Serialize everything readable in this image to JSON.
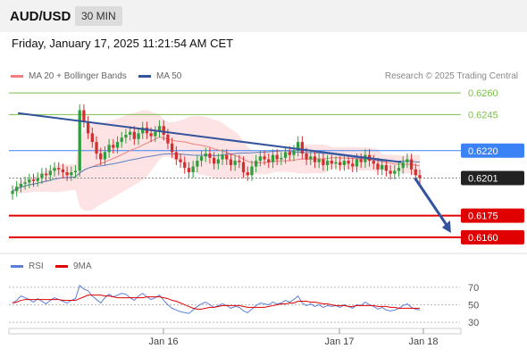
{
  "header": {
    "symbol": "AUD/USD",
    "timeframe": "30 MIN"
  },
  "datetime": "Friday, January 17, 2025 11:21:54 AM CET",
  "legend": {
    "bb_label": "MA 20 + Bollinger Bands",
    "ma50_label": "MA 50",
    "credit": "Research © 2025 Trading Central"
  },
  "rsi_legend": {
    "rsi_label": "RSI",
    "ma_label": "9MA"
  },
  "colors": {
    "up": "#2e9e3e",
    "down": "#d32f2f",
    "ma20": "#f08080",
    "ma50": "#5b7fbe",
    "band": "#fde0e0",
    "target_green": "#7cbf4c",
    "support_red": "#e00000",
    "current_blue": "#3b82f6",
    "trendline": "#33549c",
    "rsi": "#5b7fd8",
    "rsi_ma": "#e00000"
  },
  "chart_data": [
    {
      "type": "candlestick",
      "x_tick_labels": [
        "Jan 16",
        "Jan 17",
        "Jan 18"
      ],
      "y_range": [
        0.615,
        0.6265
      ],
      "levels": [
        {
          "value": 0.626,
          "label": "0.6260",
          "role": "resistance"
        },
        {
          "value": 0.6245,
          "label": "0.6245",
          "role": "resistance"
        },
        {
          "value": 0.622,
          "label": "0.6220",
          "role": "pivot"
        },
        {
          "value": 0.6201,
          "label": "0.6201",
          "role": "last"
        },
        {
          "value": 0.6175,
          "label": "0.6175",
          "role": "support"
        },
        {
          "value": 0.616,
          "label": "0.6160",
          "role": "support"
        }
      ],
      "series": [
        {
          "name": "MA 20 + Bollinger Bands"
        },
        {
          "name": "MA 50"
        }
      ],
      "trendline": {
        "from": [
          0.02,
          0.6246
        ],
        "to": [
          0.87,
          0.6212
        ]
      },
      "forecast_arrow": {
        "from": [
          0.9,
          0.6201
        ],
        "to": [
          0.98,
          0.6163
        ]
      },
      "close": [
        0.6192,
        0.6195,
        0.6197,
        0.6198,
        0.62,
        0.6199,
        0.6201,
        0.6204,
        0.6203,
        0.6206,
        0.6208,
        0.6207,
        0.6205,
        0.6203,
        0.6205,
        0.6206,
        0.6248,
        0.624,
        0.6232,
        0.6226,
        0.6218,
        0.6214,
        0.6219,
        0.6224,
        0.6222,
        0.6226,
        0.6229,
        0.6231,
        0.6233,
        0.6228,
        0.6232,
        0.6236,
        0.6232,
        0.623,
        0.6233,
        0.6237,
        0.6231,
        0.6225,
        0.6219,
        0.6214,
        0.6212,
        0.6208,
        0.6205,
        0.6209,
        0.6213,
        0.6216,
        0.6218,
        0.6215,
        0.6211,
        0.6214,
        0.6217,
        0.6214,
        0.621,
        0.6213,
        0.6212,
        0.6205,
        0.6203,
        0.6209,
        0.6213,
        0.6216,
        0.6214,
        0.6212,
        0.6217,
        0.6214,
        0.6215,
        0.6219,
        0.6217,
        0.622,
        0.6226,
        0.6218,
        0.6214,
        0.6216,
        0.6212,
        0.6214,
        0.621,
        0.6213,
        0.6211,
        0.6212,
        0.621,
        0.6213,
        0.6211,
        0.6209,
        0.6214,
        0.6212,
        0.6217,
        0.6213,
        0.6211,
        0.6207,
        0.621,
        0.6206,
        0.6204,
        0.6206,
        0.6208,
        0.6212,
        0.6214,
        0.6207,
        0.6203,
        0.6201
      ],
      "rsi": {
        "type": "line",
        "y_range": [
          25,
          80
        ],
        "y_ticks": [
          70,
          50,
          30
        ],
        "rsi_values": [
          52,
          55,
          60,
          58,
          56,
          53,
          57,
          54,
          51,
          55,
          58,
          56,
          54,
          52,
          55,
          57,
          72,
          68,
          66,
          60,
          56,
          52,
          58,
          62,
          59,
          61,
          63,
          62,
          58,
          55,
          60,
          63,
          59,
          56,
          58,
          61,
          55,
          50,
          46,
          44,
          42,
          41,
          40,
          44,
          48,
          51,
          53,
          50,
          47,
          49,
          51,
          49,
          46,
          48,
          47,
          43,
          41,
          45,
          49,
          52,
          51,
          50,
          53,
          51,
          52,
          55,
          53,
          56,
          60,
          52,
          49,
          51,
          48,
          50,
          47,
          49,
          48,
          49,
          47,
          50,
          48,
          46,
          50,
          49,
          53,
          50,
          48,
          45,
          47,
          44,
          43,
          44,
          46,
          49,
          51,
          47,
          45,
          44
        ],
        "ma_values": [
          52,
          53,
          55,
          56,
          56,
          56,
          56,
          56,
          56,
          56,
          56,
          56,
          55,
          55,
          55,
          55,
          57,
          59,
          61,
          61,
          61,
          61,
          60,
          60,
          59,
          58,
          58,
          58,
          58,
          58,
          58,
          58,
          59,
          59,
          59,
          59,
          58,
          57,
          55,
          54,
          52,
          50,
          48,
          46,
          45,
          45,
          46,
          47,
          47,
          48,
          49,
          49,
          49,
          49,
          49,
          48,
          47,
          47,
          47,
          47,
          47,
          48,
          49,
          50,
          51,
          51,
          52,
          52,
          54,
          54,
          54,
          53,
          53,
          52,
          51,
          51,
          50,
          49,
          49,
          49,
          48,
          48,
          49,
          49,
          49,
          49,
          49,
          48,
          48,
          48,
          47,
          47,
          46,
          46,
          46,
          46,
          46,
          46
        ]
      }
    }
  ]
}
